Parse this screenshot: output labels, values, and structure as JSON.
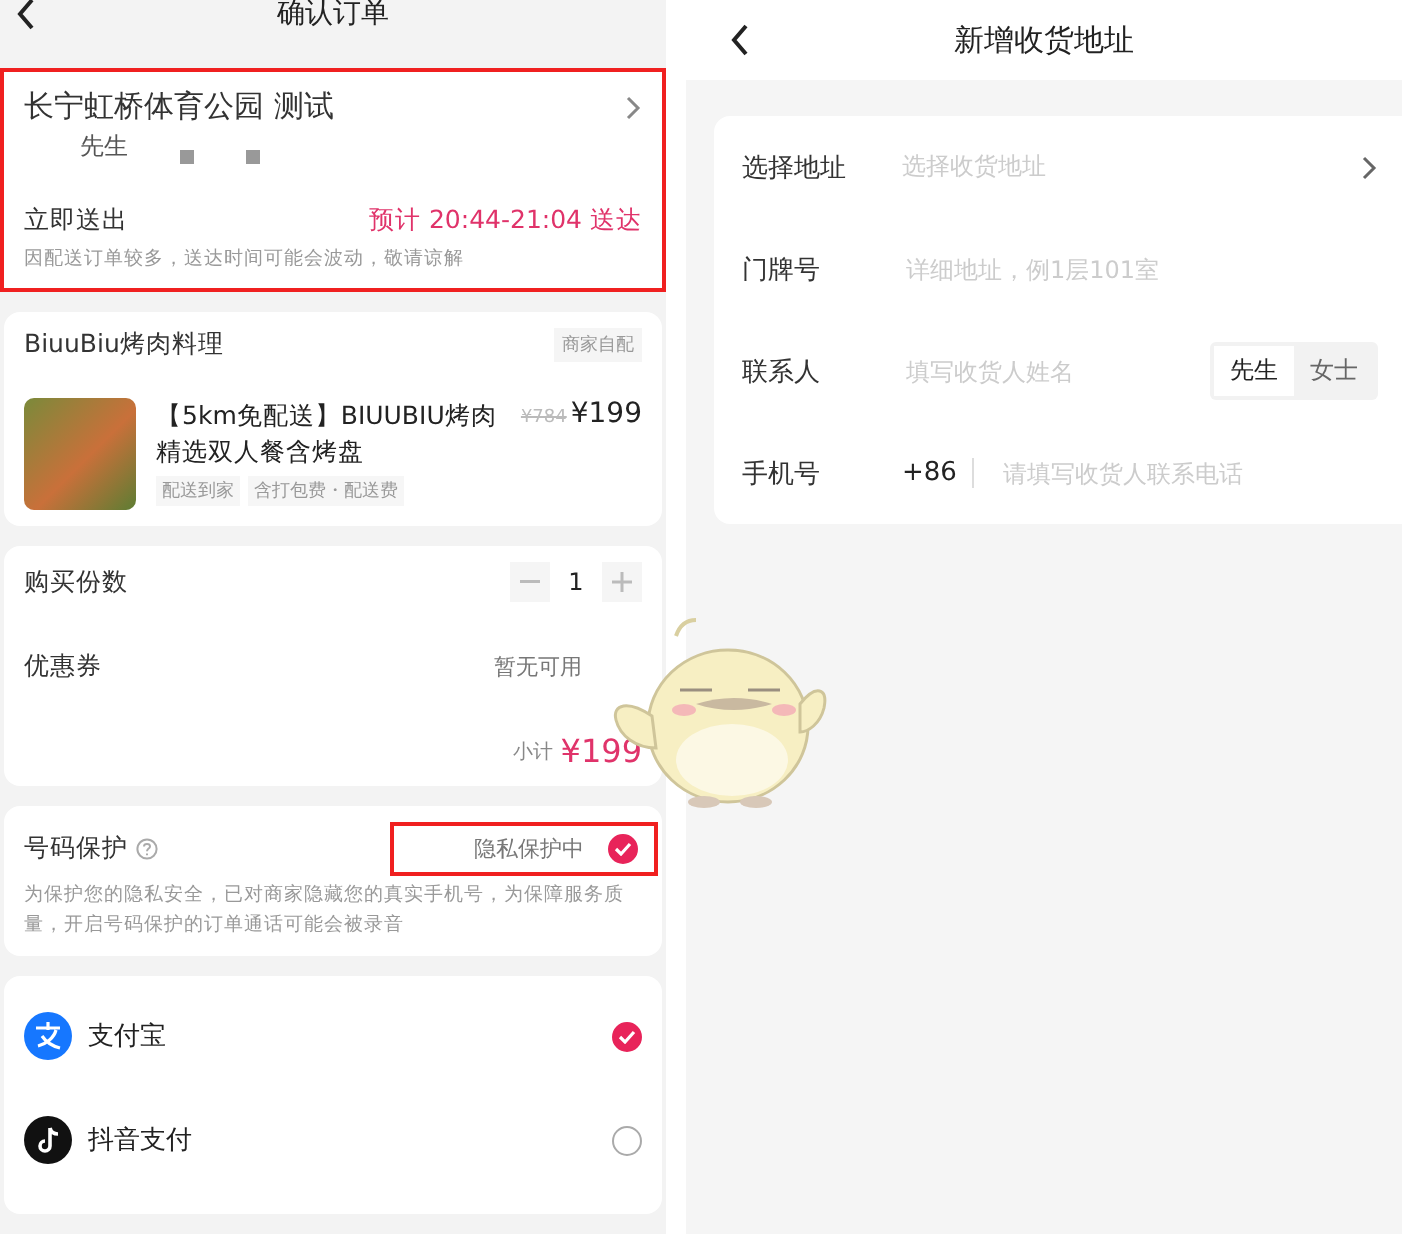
{
  "order_screen": {
    "title": "确认订单",
    "address": {
      "highlighted": true,
      "name": "长宁虹桥体育公园 测试",
      "contact": "先生",
      "dispatch": "立即送出",
      "eta": "预计 20:44-21:04 送达",
      "note": "因配送订单较多，送达时间可能会波动，敬请谅解"
    },
    "store": {
      "name": "BiuuBiu烤肉料理",
      "tag": "商家自配",
      "item": {
        "title": "【5km免配送】BIUUBIU烤肉精选双人餐含烤盘",
        "original_price": "¥784",
        "price": "¥199",
        "tags": [
          "配送到家",
          "含打包费・配送费"
        ]
      }
    },
    "quantity": {
      "label": "购买份数",
      "value": "1"
    },
    "coupon": {
      "label": "优惠券",
      "value": "暂无可用"
    },
    "subtotal": {
      "label": "小计",
      "amount": "¥199"
    },
    "privacy": {
      "label": "号码保护",
      "status": "隐私保护中",
      "checked": true,
      "highlighted": true,
      "description": "为保护您的隐私安全，已对商家隐藏您的真实手机号，为保障服务质量，开启号码保护的订单通话可能会被录音"
    },
    "payments": [
      {
        "name": "支付宝",
        "kind": "alipay",
        "selected": true
      },
      {
        "name": "抖音支付",
        "kind": "douyin",
        "selected": false
      }
    ]
  },
  "address_screen": {
    "title": "新增收货地址",
    "fields": [
      {
        "kind": "select",
        "label": "选择地址",
        "placeholder": "选择收货地址"
      },
      {
        "kind": "text",
        "label": "门牌号",
        "placeholder": "详细地址，例1层101室"
      },
      {
        "kind": "contact",
        "label": "联系人",
        "placeholder": "填写收货人姓名",
        "options": [
          {
            "label": "先生",
            "selected": true
          },
          {
            "label": "女士",
            "selected": false
          }
        ]
      },
      {
        "kind": "phone",
        "label": "手机号",
        "prefix": "+86",
        "placeholder": "请填写收货人联系电话"
      }
    ]
  }
}
